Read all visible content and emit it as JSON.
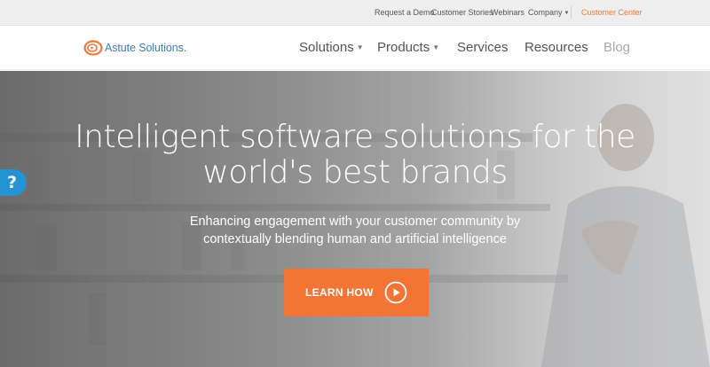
{
  "utility_bar": {
    "links": [
      {
        "label": "Request a Demo"
      },
      {
        "label": "Customer Stories"
      },
      {
        "label": "Webinars"
      },
      {
        "label": "Company"
      }
    ],
    "customer_center": "Customer Center",
    "accent_color": "#f0783a"
  },
  "header": {
    "logo_text": "Astute Solutions.",
    "nav": [
      {
        "label": "Solutions",
        "has_dropdown": true
      },
      {
        "label": "Products",
        "has_dropdown": true
      },
      {
        "label": "Services",
        "has_dropdown": false
      },
      {
        "label": "Resources",
        "has_dropdown": false
      },
      {
        "label": "Blog",
        "has_dropdown": false
      }
    ]
  },
  "hero": {
    "title_line1": "Intelligent software solutions for the",
    "title_line2": "world's best brands",
    "subtitle_line1": "Enhancing engagement with your customer community by",
    "subtitle_line2": "contextually blending human and artificial intelligence",
    "cta_label": "LEARN HOW",
    "cta_color": "#f47435"
  },
  "help_tab": {
    "label": "?",
    "color": "#2393d4"
  }
}
